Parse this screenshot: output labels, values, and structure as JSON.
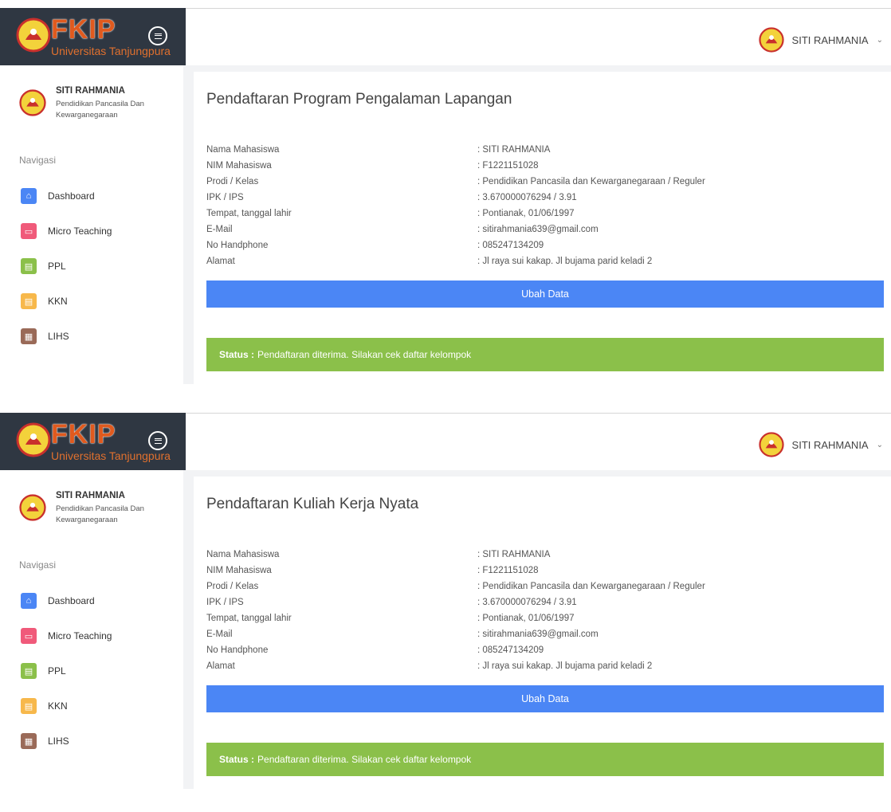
{
  "brand": {
    "title": "FKIP",
    "subtitle": "Universitas Tanjungpura"
  },
  "user": {
    "name": "SITI RAHMANIA",
    "prodi": "Pendidikan Pancasila Dan Kewarganegaraan"
  },
  "nav_title": "Navigasi",
  "nav": [
    {
      "label": "Dashboard",
      "icon": "home-icon",
      "color": "#4b86f5",
      "glyph": "⌂"
    },
    {
      "label": "Micro Teaching",
      "icon": "monitor-icon",
      "color": "#f05a7a",
      "glyph": "▭"
    },
    {
      "label": "PPL",
      "icon": "card-icon",
      "color": "#8bc04a",
      "glyph": "▤"
    },
    {
      "label": "KKN",
      "icon": "card-icon",
      "color": "#f7b84b",
      "glyph": "▤"
    },
    {
      "label": "LIHS",
      "icon": "grid-icon",
      "color": "#9a6a58",
      "glyph": "▦"
    }
  ],
  "screens": [
    {
      "title": "Pendaftaran Program Pengalaman Lapangan"
    },
    {
      "title": "Pendaftaran Kuliah Kerja Nyata"
    }
  ],
  "info": [
    {
      "label": "Nama Mahasiswa",
      "value": ": SITI RAHMANIA"
    },
    {
      "label": "NIM Mahasiswa",
      "value": ": F1221151028"
    },
    {
      "label": "Prodi / Kelas",
      "value": ": Pendidikan Pancasila dan Kewarganegaraan / Reguler"
    },
    {
      "label": "IPK / IPS",
      "value": ": 3.670000076294 / 3.91"
    },
    {
      "label": "Tempat, tanggal lahir",
      "value": ": Pontianak, 01/06/1997"
    },
    {
      "label": "E-Mail",
      "value": ": sitirahmania639@gmail.com"
    },
    {
      "label": "No Handphone",
      "value": ": 085247134209"
    },
    {
      "label": "Alamat",
      "value": ": Jl raya sui kakap. Jl bujama parid keladi 2"
    }
  ],
  "ubah_label": "Ubah Data",
  "status": {
    "label": "Status :",
    "text": "Pendaftaran diterima. Silakan cek daftar kelompok"
  },
  "colors": {
    "primary": "#4b86f5",
    "success": "#8bc04a",
    "header": "#2f3742"
  }
}
